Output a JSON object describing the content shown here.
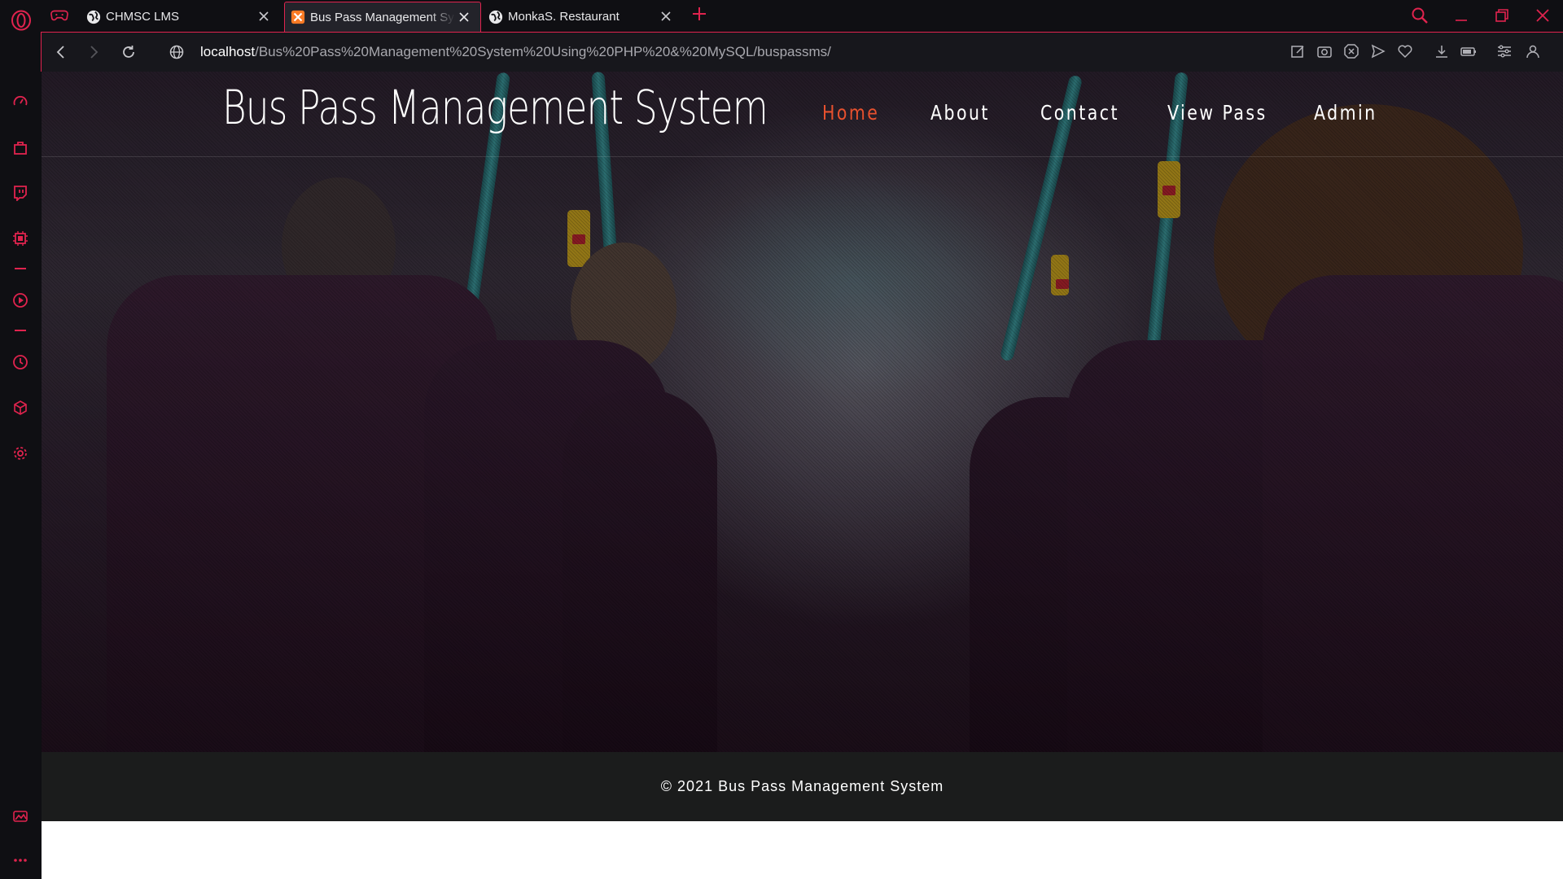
{
  "browser": {
    "accent_color": "#e0234e",
    "tabs": [
      {
        "title": "CHMSC LMS",
        "favicon": "globe-icon"
      },
      {
        "title": "Bus Pass Management System",
        "favicon": "xampp-icon",
        "active": true
      },
      {
        "title": "MonkaS. Restaurant",
        "favicon": "globe-icon"
      }
    ],
    "address": {
      "host": "localhost",
      "path": "/Bus%20Pass%20Management%20System%20Using%20PHP%20&%20MySQL/buspassms/"
    },
    "sidebar_icons": [
      "speed-dial-icon",
      "shopping-bag-icon",
      "twitch-icon",
      "game-controller-icon",
      "player-icon",
      "history-icon",
      "extensions-icon",
      "settings-icon",
      "photo-icon",
      "more-icon"
    ]
  },
  "site": {
    "title": "Bus Pass Management System",
    "nav": [
      "Home",
      "About",
      "Contact",
      "View Pass",
      "Admin"
    ],
    "nav_active": "Home",
    "nav_active_color": "#e8512e",
    "footer": "© 2021 Bus Pass Management System"
  }
}
